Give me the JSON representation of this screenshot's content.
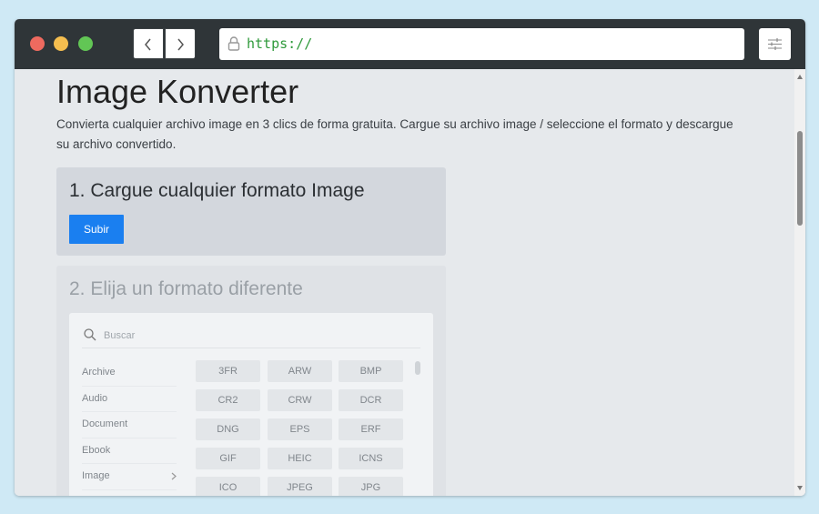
{
  "browser": {
    "url": "https://"
  },
  "page": {
    "title": "Image Konverter",
    "description": "Convierta cualquier archivo image en 3 clics de forma gratuita. Cargue su archivo image / seleccione el formato y descargue su archivo convertido."
  },
  "step1": {
    "heading": "1. Cargue cualquier formato Image",
    "button_label": "Subir"
  },
  "step2": {
    "heading": "2. Elija un formato diferente",
    "search_placeholder": "Buscar",
    "categories": [
      "Archive",
      "Audio",
      "Document",
      "Ebook",
      "Image"
    ],
    "formats": [
      "3FR",
      "ARW",
      "BMP",
      "CR2",
      "CRW",
      "DCR",
      "DNG",
      "EPS",
      "ERF",
      "GIF",
      "HEIC",
      "ICNS",
      "ICO",
      "JPEG",
      "JPG"
    ]
  },
  "colors": {
    "titlebar": "#2f3538",
    "url_text": "#2f9a3b",
    "button": "#1a7ff0",
    "background": "#cfe9f5"
  }
}
